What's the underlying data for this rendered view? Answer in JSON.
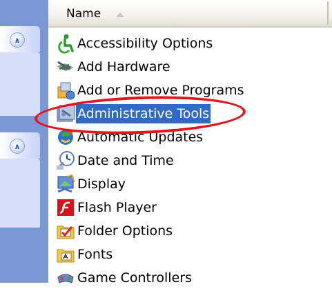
{
  "header": {
    "name_label": "Name"
  },
  "items": [
    {
      "label": "Accessibility Options",
      "icon": "accessibility-icon"
    },
    {
      "label": "Add Hardware",
      "icon": "add-hardware-icon"
    },
    {
      "label": "Add or Remove Programs",
      "icon": "add-remove-programs-icon"
    },
    {
      "label": "Administrative Tools",
      "icon": "administrative-tools-icon",
      "selected": true
    },
    {
      "label": "Automatic Updates",
      "icon": "automatic-updates-icon"
    },
    {
      "label": "Date and Time",
      "icon": "date-time-icon"
    },
    {
      "label": "Display",
      "icon": "display-icon"
    },
    {
      "label": "Flash Player",
      "icon": "flash-player-icon"
    },
    {
      "label": "Folder Options",
      "icon": "folder-options-icon"
    },
    {
      "label": "Fonts",
      "icon": "fonts-folder-icon"
    },
    {
      "label": "Game Controllers",
      "icon": "game-controllers-icon"
    }
  ],
  "colors": {
    "selection": "#316ac5",
    "annotation_circle": "#e3151b",
    "taskpane": "#7c97d6"
  }
}
